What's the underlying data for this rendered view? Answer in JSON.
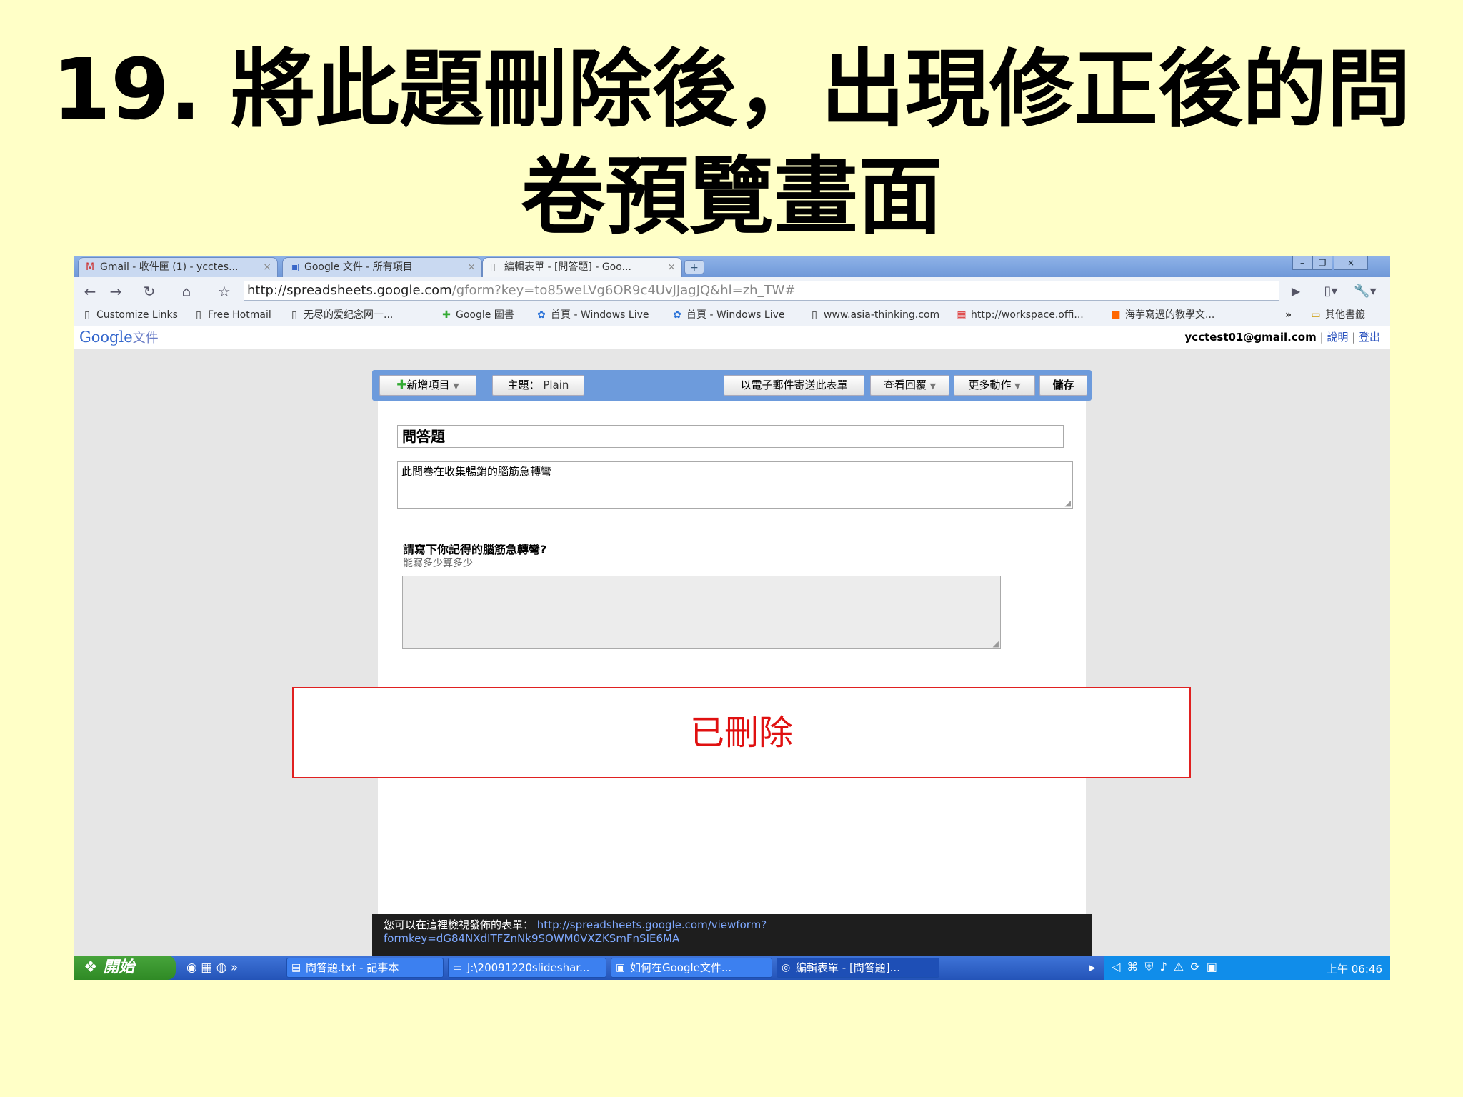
{
  "slide": {
    "title_line1": "19. 將此題刪除後，出現修正後的問",
    "title_line2": "卷預覽畫面"
  },
  "browser": {
    "tabs": [
      {
        "label": "Gmail - 收件匣 (1) - ycctes...",
        "icon": "gmail-icon"
      },
      {
        "label": "Google 文件 - 所有項目",
        "icon": "docs-icon"
      },
      {
        "label": "編輯表單 - [問答題] - Goo...",
        "icon": "page-icon",
        "active": true
      }
    ],
    "new_tab_label": "+",
    "url_host": "http://spreadsheets.google.com",
    "url_path": "/gform?key=to85weLVg6OR9c4UvJJagJQ&hl=zh_TW#",
    "bookmarks": [
      {
        "label": "Customize Links",
        "icon": "page-icon"
      },
      {
        "label": "Free Hotmail",
        "icon": "page-icon"
      },
      {
        "label": "无尽的爱纪念网一...",
        "icon": "page-icon"
      },
      {
        "label": "Google 圖書",
        "icon": "google-books-icon"
      },
      {
        "label": "首頁 - Windows Live",
        "icon": "windows-live-icon"
      },
      {
        "label": "首頁 - Windows Live",
        "icon": "windows-live-icon"
      },
      {
        "label": "www.asia-thinking.com",
        "icon": "page-icon"
      },
      {
        "label": "http://workspace.offi...",
        "icon": "office-icon"
      },
      {
        "label": "海芋寫過的教學文...",
        "icon": "blogger-icon"
      }
    ],
    "other_bookmarks": "其他書籤",
    "overflow": "»"
  },
  "google_bar": {
    "logo": "Google",
    "product": "文件",
    "email": "ycctest01@gmail.com",
    "help": "說明",
    "signout": "登出",
    "sep": "|"
  },
  "form_toolbar": {
    "add_item": "新增項目",
    "theme_label": "主題：",
    "theme_value": "Plain",
    "email_form": "以電子郵件寄送此表單",
    "view_responses": "查看回覆",
    "more_actions": "更多動作",
    "save": "儲存"
  },
  "form": {
    "title": "問答題",
    "description": "此問卷在收集暢銷的腦筋急轉彎",
    "question_title": "請寫下你記得的腦筋急轉彎?",
    "question_help": "能寫多少算多少"
  },
  "deleted_notice": "已刪除",
  "footer": {
    "text": "您可以在這裡檢視發佈的表單：",
    "link_line1": "http://spreadsheets.google.com/viewform?",
    "link_line2": "formkey=dG84NXdITFZnNk9SOWM0VXZKSmFnSIE6MA"
  },
  "taskbar": {
    "start": "開始",
    "tasks": [
      {
        "label": "問答題.txt - 記事本",
        "icon": "notepad-icon"
      },
      {
        "label": "J:\\20091220slideshar...",
        "icon": "folder-icon"
      },
      {
        "label": "如何在Google文件...",
        "icon": "powerpoint-icon"
      },
      {
        "label": "編輯表單 - [問答題]...",
        "icon": "chrome-icon",
        "active": true
      }
    ],
    "clock": "上午 06:46"
  }
}
